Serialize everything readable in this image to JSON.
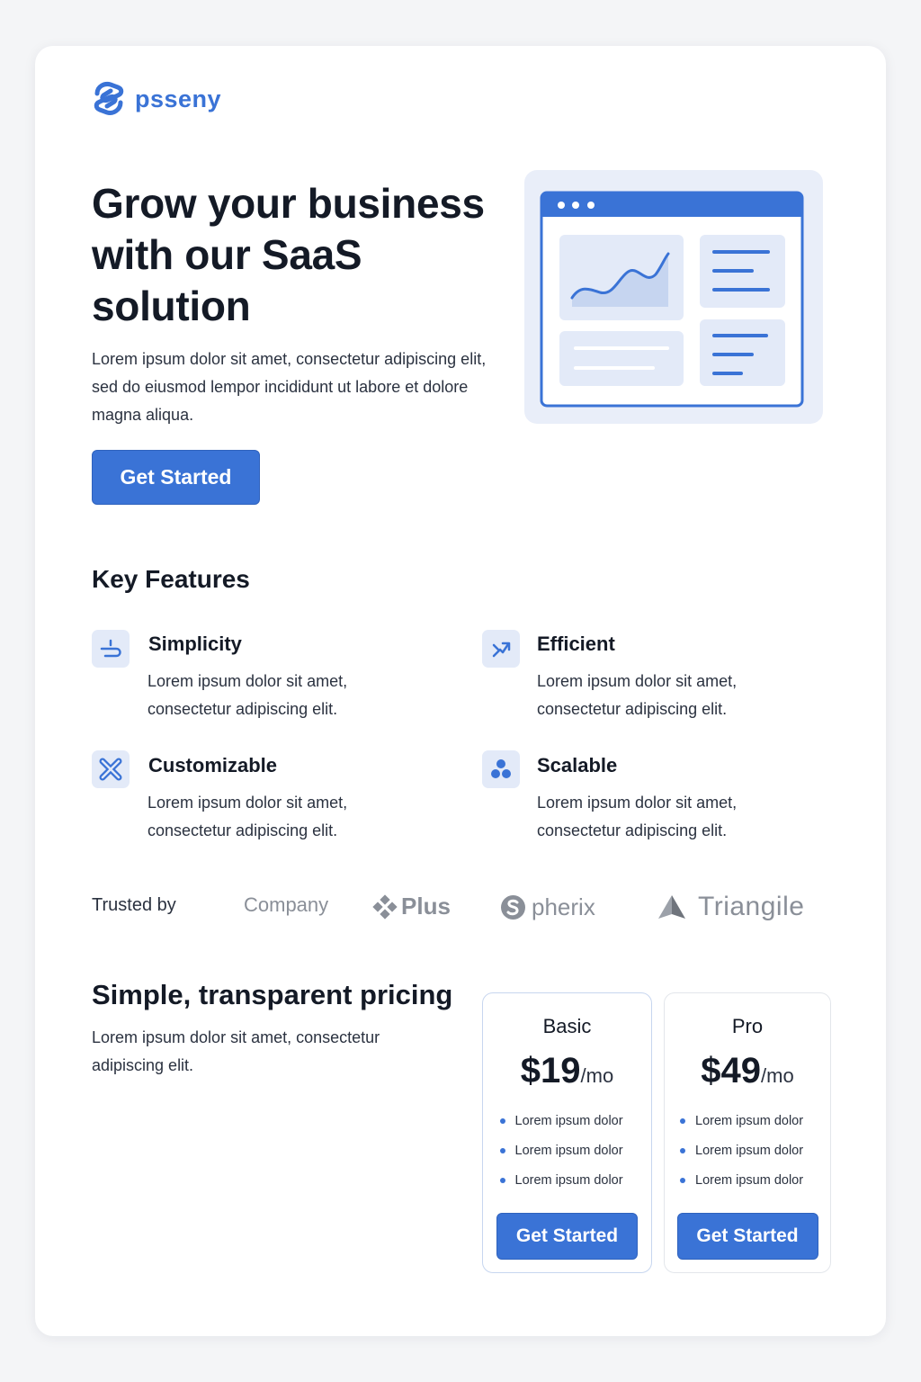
{
  "brand": {
    "name": "psseny",
    "logo_icon": "brand-logo-icon"
  },
  "hero": {
    "title": "Grow your business with our SaaS solution",
    "text": "Lorem ipsum dolor sit amet, consectetur adipiscing elit, sed do eiusmod lempor incididunt ut labore et dolore magna aliqua.",
    "cta_label": "Get Started",
    "illustration_icon": "dashboard-illustration"
  },
  "features": {
    "title": "Key Features",
    "items": [
      {
        "name": "Simplicity",
        "desc": "Lorem ipsum dolor sit amet, consectetur adipiscing elit.",
        "icon": "simplicity-icon"
      },
      {
        "name": "Efficient",
        "desc": "Lorem ipsum dolor sit amet, consectetur adipiscing elit.",
        "icon": "efficient-icon"
      },
      {
        "name": "Customizable",
        "desc": "Lorem ipsum dolor sit amet, consectetur adipiscing elit.",
        "icon": "customizable-icon"
      },
      {
        "name": "Scalable",
        "desc": "Lorem ipsum dolor sit amet, consectetur adipiscing elit.",
        "icon": "scalable-icon"
      }
    ]
  },
  "trusted": {
    "label": "Trusted by",
    "logos": [
      "Company",
      "Plus",
      "pherix",
      "Triangile"
    ]
  },
  "pricing": {
    "title": "Simple, transparent pricing",
    "text": "Lorem ipsum dolor sit amet, consectetur adipiscing elit.",
    "plans": [
      {
        "name": "Basic",
        "price": "$19",
        "unit": "/mo",
        "features": [
          "Lorem ipsum dolor",
          "Lorem ipsum dolor",
          "Lorem ipsum dolor"
        ],
        "cta_label": "Get Started"
      },
      {
        "name": "Pro",
        "price": "$49",
        "unit": "/mo",
        "features": [
          "Lorem ipsum dolor",
          "Lorem ipsum dolor",
          "Lorem ipsum dolor"
        ],
        "cta_label": "Get Started"
      }
    ]
  },
  "colors": {
    "accent": "#3a73d6",
    "accent_light": "#e3eaf8",
    "text": "#141a26",
    "muted": "#8a8f98"
  }
}
